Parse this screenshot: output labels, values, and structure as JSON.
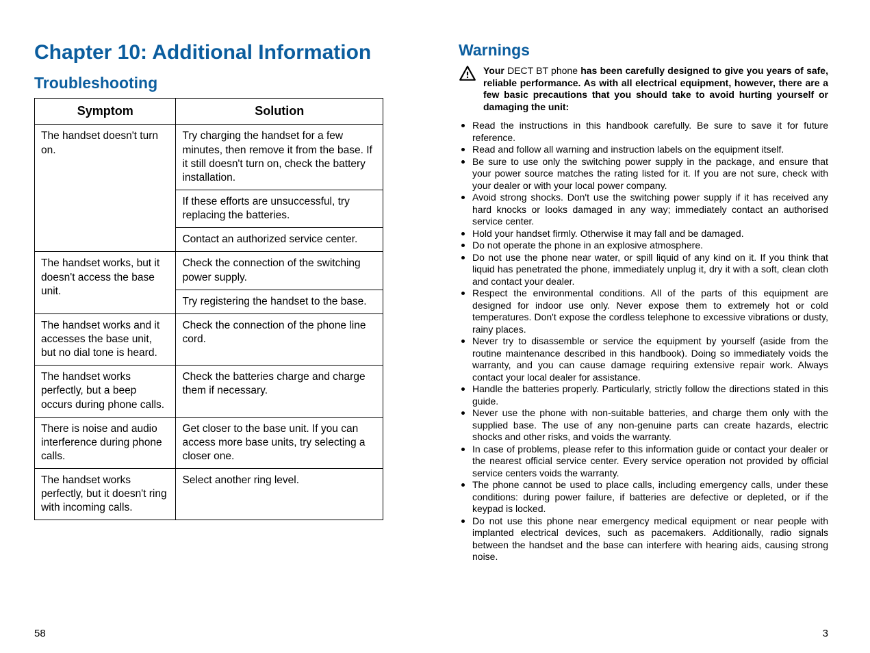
{
  "left": {
    "chapter_title": "Chapter 10: Additional Information",
    "section_title": "Troubleshooting",
    "table": {
      "head_symptom": "Symptom",
      "head_solution": "Solution",
      "r1_symptom": "The handset doesn't turn on.",
      "r1_sol_a": "Try charging the handset for a few minutes, then remove it from the base. If it still doesn't turn on, check the battery installation.",
      "r1_sol_b": "If these efforts are unsuccessful, try replacing the batteries.",
      "r1_sol_c": "Contact an authorized service center.",
      "r2_symptom": "The handset works, but it doesn't access the base unit.",
      "r2_sol_a": "Check the connection of the switching power supply.",
      "r2_sol_b": "Try registering the handset to the base.",
      "r3_symptom": "The handset works and it accesses the base unit, but no dial tone is heard.",
      "r3_sol": "Check the connection of the phone line cord.",
      "r4_symptom": "The handset works perfectly, but a beep occurs during phone calls.",
      "r4_sol": "Check the batteries charge and charge them if necessary.",
      "r5_symptom": "There is noise and audio interference during phone calls.",
      "r5_sol": "Get closer to the base unit. If you can access more base units, try selecting a closer one.",
      "r6_symptom": "The handset works perfectly, but it doesn't ring with incoming calls.",
      "r6_sol": "Select another ring level."
    },
    "page_num": "58"
  },
  "right": {
    "section_title": "Warnings",
    "intro_prefix": "Your ",
    "intro_model": "DECT BT phone",
    "intro_suffix": " has been carefully designed to give you years of safe, reliable performance. As with all electrical equipment, however, there are a few basic precautions that you should take to avoid hurting yourself or damaging the unit:",
    "bullets": [
      "Read the instructions in this handbook carefully. Be sure to save it for future reference.",
      "Read and follow all warning and instruction labels on the equipment itself.",
      "Be sure to use only the switching power supply in the package, and ensure that your power source matches the rating listed for it. If you are not sure, check with your dealer or with your local power company.",
      "Avoid strong shocks. Don't use the switching power supply if it has received any hard knocks or looks damaged in any way; immediately contact an authorised service center.",
      "Hold your handset firmly. Otherwise it may fall and be damaged.",
      "Do not operate the phone in an explosive atmosphere.",
      "Do not use the phone near water, or spill liquid of any kind on it. If you think that liquid has penetrated the phone, immediately unplug it, dry it with a soft, clean cloth and contact your dealer.",
      "Respect the environmental conditions. All of the parts of this equipment are designed for indoor use only. Never expose them to extremely hot or cold temperatures. Don't expose the cordless telephone to excessive vibrations or dusty, rainy places.",
      "Never try to disassemble or service the equipment by yourself (aside from the routine maintenance described in this handbook). Doing so immediately voids the warranty, and you can cause damage requiring extensive repair work. Always contact your local dealer for assistance.",
      "Handle the batteries properly. Particularly, strictly follow the directions stated in this guide.",
      "Never use the phone with non-suitable batteries, and charge them only with the supplied base. The use of any non-genuine parts can create hazards, electric shocks and other risks, and voids the warranty.",
      "In case of problems, please refer to this information guide or contact your dealer or the nearest official service center. Every service operation not provided by official service centers voids the warranty.",
      "The phone cannot be used to place calls, including emergency calls, under these conditions: during power failure, if batteries are defective or depleted, or if the keypad is locked.",
      "Do not use this phone near emergency medical equipment or near people with implanted electrical devices, such as pacemakers. Additionally, radio signals between the handset and the base can interfere with hearing aids, causing strong noise."
    ],
    "page_num": "3"
  }
}
